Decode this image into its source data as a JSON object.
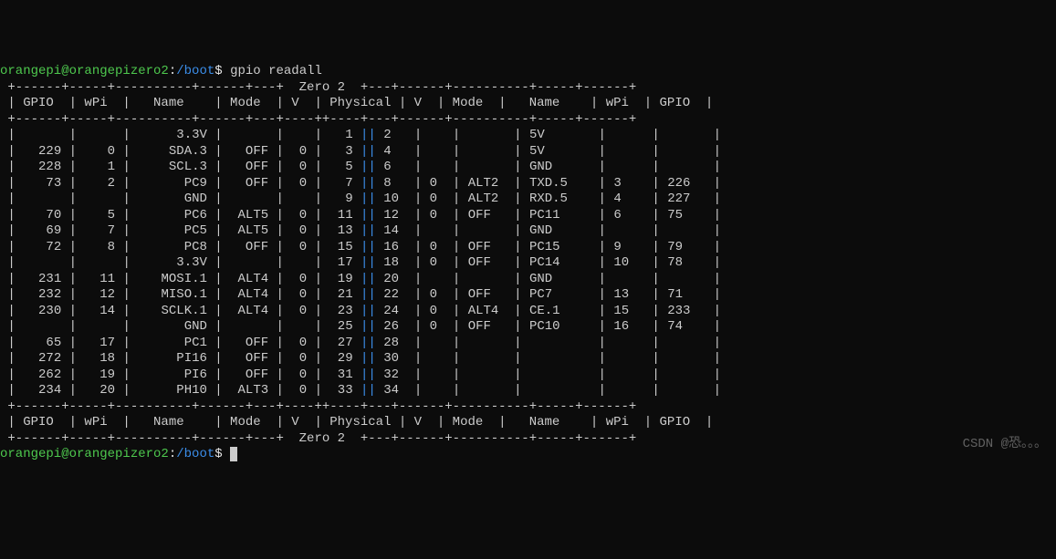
{
  "prompt1": {
    "user": "orangepi",
    "host": "orangepizero2",
    "path": "/boot",
    "symbol": "$",
    "command": "gpio readall"
  },
  "prompt2": {
    "user": "orangepi",
    "host": "orangepizero2",
    "path": "/boot",
    "symbol": "$",
    "command": ""
  },
  "board_title": "Zero 2",
  "headers": [
    "GPIO",
    "wPi",
    "Name",
    "Mode",
    "V",
    "Physical",
    "V",
    "Mode",
    "Name",
    "wPi",
    "GPIO"
  ],
  "divider_section": " +------+-----+----------+------+---+",
  "divider_title_pre": "  ",
  "divider_title_post": " +---+------+----------+-----+------+",
  "divider_plain": " +------+-----+----------+------+---+----++----+---+------+----------+-----+------+",
  "rows": [
    {
      "l_gpio": "",
      "l_wpi": "",
      "l_name": "3.3V",
      "l_mode": "",
      "l_v": "",
      "phys_l": "1",
      "phys_r": "2",
      "r_v": "",
      "r_mode": "",
      "r_name": "5V",
      "r_wpi": "",
      "r_gpio": ""
    },
    {
      "l_gpio": "229",
      "l_wpi": "0",
      "l_name": "SDA.3",
      "l_mode": "OFF",
      "l_v": "0",
      "phys_l": "3",
      "phys_r": "4",
      "r_v": "",
      "r_mode": "",
      "r_name": "5V",
      "r_wpi": "",
      "r_gpio": ""
    },
    {
      "l_gpio": "228",
      "l_wpi": "1",
      "l_name": "SCL.3",
      "l_mode": "OFF",
      "l_v": "0",
      "phys_l": "5",
      "phys_r": "6",
      "r_v": "",
      "r_mode": "",
      "r_name": "GND",
      "r_wpi": "",
      "r_gpio": ""
    },
    {
      "l_gpio": "73",
      "l_wpi": "2",
      "l_name": "PC9",
      "l_mode": "OFF",
      "l_v": "0",
      "phys_l": "7",
      "phys_r": "8",
      "r_v": "0",
      "r_mode": "ALT2",
      "r_name": "TXD.5",
      "r_wpi": "3",
      "r_gpio": "226"
    },
    {
      "l_gpio": "",
      "l_wpi": "",
      "l_name": "GND",
      "l_mode": "",
      "l_v": "",
      "phys_l": "9",
      "phys_r": "10",
      "r_v": "0",
      "r_mode": "ALT2",
      "r_name": "RXD.5",
      "r_wpi": "4",
      "r_gpio": "227"
    },
    {
      "l_gpio": "70",
      "l_wpi": "5",
      "l_name": "PC6",
      "l_mode": "ALT5",
      "l_v": "0",
      "phys_l": "11",
      "phys_r": "12",
      "r_v": "0",
      "r_mode": "OFF",
      "r_name": "PC11",
      "r_wpi": "6",
      "r_gpio": "75"
    },
    {
      "l_gpio": "69",
      "l_wpi": "7",
      "l_name": "PC5",
      "l_mode": "ALT5",
      "l_v": "0",
      "phys_l": "13",
      "phys_r": "14",
      "r_v": "",
      "r_mode": "",
      "r_name": "GND",
      "r_wpi": "",
      "r_gpio": ""
    },
    {
      "l_gpio": "72",
      "l_wpi": "8",
      "l_name": "PC8",
      "l_mode": "OFF",
      "l_v": "0",
      "phys_l": "15",
      "phys_r": "16",
      "r_v": "0",
      "r_mode": "OFF",
      "r_name": "PC15",
      "r_wpi": "9",
      "r_gpio": "79"
    },
    {
      "l_gpio": "",
      "l_wpi": "",
      "l_name": "3.3V",
      "l_mode": "",
      "l_v": "",
      "phys_l": "17",
      "phys_r": "18",
      "r_v": "0",
      "r_mode": "OFF",
      "r_name": "PC14",
      "r_wpi": "10",
      "r_gpio": "78"
    },
    {
      "l_gpio": "231",
      "l_wpi": "11",
      "l_name": "MOSI.1",
      "l_mode": "ALT4",
      "l_v": "0",
      "phys_l": "19",
      "phys_r": "20",
      "r_v": "",
      "r_mode": "",
      "r_name": "GND",
      "r_wpi": "",
      "r_gpio": ""
    },
    {
      "l_gpio": "232",
      "l_wpi": "12",
      "l_name": "MISO.1",
      "l_mode": "ALT4",
      "l_v": "0",
      "phys_l": "21",
      "phys_r": "22",
      "r_v": "0",
      "r_mode": "OFF",
      "r_name": "PC7",
      "r_wpi": "13",
      "r_gpio": "71"
    },
    {
      "l_gpio": "230",
      "l_wpi": "14",
      "l_name": "SCLK.1",
      "l_mode": "ALT4",
      "l_v": "0",
      "phys_l": "23",
      "phys_r": "24",
      "r_v": "0",
      "r_mode": "ALT4",
      "r_name": "CE.1",
      "r_wpi": "15",
      "r_gpio": "233"
    },
    {
      "l_gpio": "",
      "l_wpi": "",
      "l_name": "GND",
      "l_mode": "",
      "l_v": "",
      "phys_l": "25",
      "phys_r": "26",
      "r_v": "0",
      "r_mode": "OFF",
      "r_name": "PC10",
      "r_wpi": "16",
      "r_gpio": "74"
    },
    {
      "l_gpio": "65",
      "l_wpi": "17",
      "l_name": "PC1",
      "l_mode": "OFF",
      "l_v": "0",
      "phys_l": "27",
      "phys_r": "28",
      "r_v": "",
      "r_mode": "",
      "r_name": "",
      "r_wpi": "",
      "r_gpio": ""
    },
    {
      "l_gpio": "272",
      "l_wpi": "18",
      "l_name": "PI16",
      "l_mode": "OFF",
      "l_v": "0",
      "phys_l": "29",
      "phys_r": "30",
      "r_v": "",
      "r_mode": "",
      "r_name": "",
      "r_wpi": "",
      "r_gpio": ""
    },
    {
      "l_gpio": "262",
      "l_wpi": "19",
      "l_name": "PI6",
      "l_mode": "OFF",
      "l_v": "0",
      "phys_l": "31",
      "phys_r": "32",
      "r_v": "",
      "r_mode": "",
      "r_name": "",
      "r_wpi": "",
      "r_gpio": ""
    },
    {
      "l_gpio": "234",
      "l_wpi": "20",
      "l_name": "PH10",
      "l_mode": "ALT3",
      "l_v": "0",
      "phys_l": "33",
      "phys_r": "34",
      "r_v": "",
      "r_mode": "",
      "r_name": "",
      "r_wpi": "",
      "r_gpio": ""
    }
  ],
  "widths": {
    "gpio": 5,
    "wpi": 4,
    "name": 9,
    "mode": 5,
    "v": 2,
    "phys": 3,
    "rname": 7
  },
  "watermark": "CSDN @恐。。。"
}
